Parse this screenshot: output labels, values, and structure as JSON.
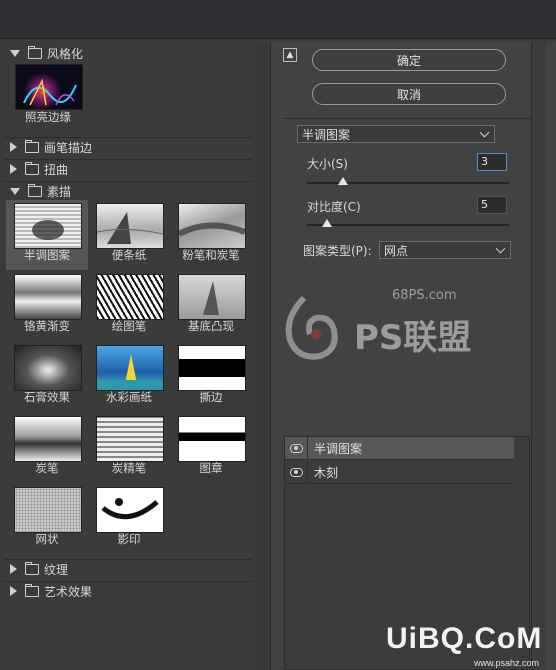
{
  "gallery": {
    "categories": [
      {
        "label": "风格化",
        "expanded": true
      },
      {
        "label": "画笔描边",
        "expanded": false
      },
      {
        "label": "扭曲",
        "expanded": false
      },
      {
        "label": "素描",
        "expanded": true
      },
      {
        "label": "纹理",
        "expanded": false
      },
      {
        "label": "艺术效果",
        "expanded": false
      }
    ],
    "stylize_items": [
      "照亮边缘"
    ],
    "sketch_items": [
      "半调图案",
      "便条纸",
      "粉笔和炭笔",
      "铬黄渐变",
      "绘图笔",
      "基底凸现",
      "石膏效果",
      "水彩画纸",
      "撕边",
      "炭笔",
      "炭精笔",
      "图章",
      "网状",
      "影印"
    ],
    "selected": "半调图案"
  },
  "buttons": {
    "ok": "确定",
    "cancel": "取消",
    "collapse_icon": "▲"
  },
  "settings": {
    "filter_select": "半调图案",
    "size_label": "大小(S)",
    "size_value": "3",
    "contrast_label": "对比度(C)",
    "contrast_value": "5",
    "pattern_type_label": "图案类型(P):",
    "pattern_type_value": "网点",
    "size_fraction": 0.18,
    "contrast_fraction": 0.1
  },
  "layers": [
    {
      "label": "半调图案",
      "visible": true
    },
    {
      "label": "木刻",
      "visible": true
    }
  ],
  "watermark": {
    "site1": "68PS.com",
    "brand1": "PS联盟",
    "site2": "UiBQ.CoM",
    "site2_small": "www.psahz.com"
  },
  "colors": {
    "panel": "#3b3b3b",
    "accent": "#4b8fd6"
  }
}
